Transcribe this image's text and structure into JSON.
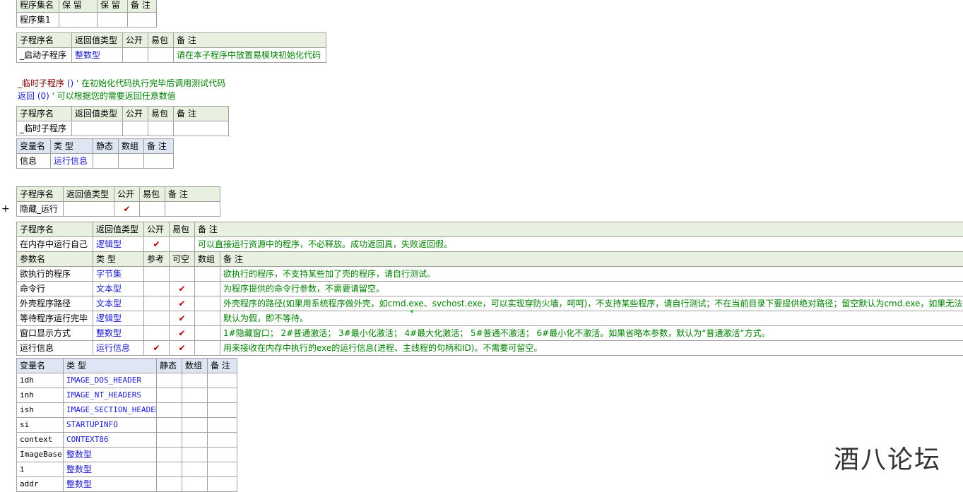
{
  "assembly": {
    "headers": [
      "程序集名",
      "保 留",
      "保 留",
      "备 注"
    ],
    "name": "程序集1"
  },
  "start_sub": {
    "headers": [
      "子程序名",
      "返回值类型",
      "公开",
      "易包",
      "备 注"
    ],
    "name": "_启动子程序",
    "return_type": "整数型",
    "note": "请在本子程序中放置易模块初始化代码"
  },
  "code_lines": {
    "line1_name": "_临时子程序",
    "line1_args": "()",
    "line1_comment": "' 在初始化代码执行完毕后调用测试代码",
    "line2_kw": "返回",
    "line2_args": "(0)",
    "line2_comment": "' 可以根据您的需要返回任意数值"
  },
  "temp_sub": {
    "headers": [
      "子程序名",
      "返回值类型",
      "公开",
      "易包",
      "备 注"
    ],
    "name": "_临时子程序",
    "var_headers": [
      "变量名",
      "类 型",
      "静态",
      "数组",
      "备 注"
    ],
    "var_name": "信息",
    "var_type": "运行信息"
  },
  "hide_run": {
    "headers": [
      "子程序名",
      "返回值类型",
      "公开",
      "易包",
      "备 注"
    ],
    "name": "隐藏_运行",
    "check": "✔"
  },
  "mem_run": {
    "headers": [
      "子程序名",
      "返回值类型",
      "公开",
      "易包",
      "备 注"
    ],
    "name": "在内存中运行自己",
    "return_type": "逻辑型",
    "check": "✔",
    "note": "可以直接运行资源中的程序，不必释放。成功返回真，失败返回假。",
    "param_headers": [
      "参数名",
      "类 型",
      "参考",
      "可空",
      "数组",
      "备 注"
    ],
    "params": [
      {
        "name": "欲执行的程序",
        "type": "字节集",
        "ref": "",
        "nullable": "",
        "note": "欲执行的程序，不支持某些加了壳的程序，请自行测试。"
      },
      {
        "name": "命令行",
        "type": "文本型",
        "ref": "",
        "nullable": "✔",
        "note": "为程序提供的命令行参数，不需要请留空。"
      },
      {
        "name": "外壳程序路径",
        "type": "文本型",
        "ref": "",
        "nullable": "✔",
        "note": "外壳程序的路径(如果用系统程序做外壳，如cmd.exe、svchost.exe，可以实现穿防火墙，呵呵)，不支持某些程序，请自行测试；不在当前目录下要提供绝对路径；留空默认为cmd.exe，如果无法运行"
      },
      {
        "name": "等待程序运行完毕",
        "type": "逻辑型",
        "ref": "",
        "nullable": "✔",
        "note": "默认为假，即不等待。"
      },
      {
        "name": "窗口显示方式",
        "type": "整数型",
        "ref": "",
        "nullable": "✔",
        "note": "1#隐藏窗口； 2#普通激活； 3#最小化激活； 4#最大化激活； 5#普通不激活； 6#最小化不激活。如果省略本参数，默认为“普通激活”方式。"
      },
      {
        "name": "运行信息",
        "type": "运行信息",
        "ref": "✔",
        "nullable": "✔",
        "note": "用来接收在内存中执行的exe的运行信息(进程、主线程的句柄和ID)。不需要可留空。"
      }
    ],
    "var_headers": [
      "变量名",
      "类 型",
      "静态",
      "数组",
      "备 注"
    ],
    "vars": [
      {
        "name": "idh",
        "type": "IMAGE_DOS_HEADER"
      },
      {
        "name": "inh",
        "type": "IMAGE_NT_HEADERS"
      },
      {
        "name": "ish",
        "type": "IMAGE_SECTION_HEADER"
      },
      {
        "name": "si",
        "type": "STARTUPINFO"
      },
      {
        "name": "context",
        "type": "CONTEXT86"
      },
      {
        "name": "ImageBase",
        "type": "整数型"
      },
      {
        "name": "i",
        "type": "整数型"
      },
      {
        "name": "addr",
        "type": "整数型"
      }
    ]
  },
  "watermark": "酒八论坛"
}
